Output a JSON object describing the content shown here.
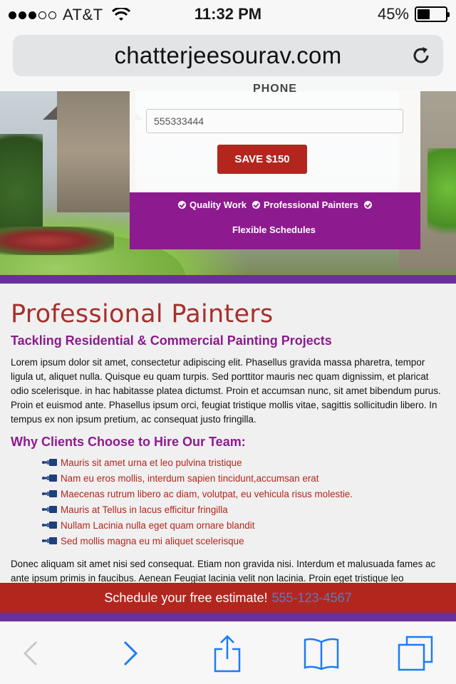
{
  "status_bar": {
    "carrier": "AT&T",
    "time": "11:32 PM",
    "battery": "45%",
    "battery_level": 0.45,
    "signal_bars_filled": 3,
    "signal_bars_total": 5
  },
  "browser": {
    "url": "chatterjeesourav.com"
  },
  "form": {
    "phone_label": "PHONE",
    "phone_value": "555333444",
    "save_label": "SAVE $150",
    "features": [
      "Quality Work",
      "Professional Painters",
      "Flexible Schedules"
    ]
  },
  "main": {
    "title": "Professional Painters",
    "subtitle": "Tackling Residential & Commercial Painting Projects",
    "paragraph": "Lorem ipsum dolor sit amet, consectetur adipiscing elit. Phasellus gravida massa pharetra, tempor ligula ut, aliquet nulla. Quisque eu quam turpis. Sed porttitor mauris nec quam dignissim, et plaricat odio scelerisque. in hac habitasse platea dictumst. Proin et accumsan nunc, sit amet bibendum purus. Proin et euismod ante. Phasellus ipsum orci, feugiat tristique mollis vitae, sagittis sollicitudin libero. In tempus ex non ipsum pretium, ac consequat justo fringilla.",
    "why_title": "Why Clients Choose to Hire Our Team:",
    "reasons": [
      "Mauris sit amet urna et leo pulvina tristique",
      "Nam eu eros mollis, interdum sapien tincidunt,accumsan erat",
      "Maecenas rutrum libero ac diam, volutpat, eu vehicula risus molestie.",
      "Mauris at Tellus in lacus efficitur fringilla",
      "Nullam Lacinia nulla eget quam ornare blandit",
      "Sed mollis magna eu mi aliquet scelerisque"
    ],
    "paragraph2": "Donec aliquam sit amet nisi sed consequat. Etiam non gravida nisi. Interdum et malusuada fames ac ante ipsum primis in faucibus. Aenean Feugiat lacinia velit non lacinia. Proin eget tristique leo"
  },
  "cta": {
    "text": "Schedule your free estimate!",
    "phone": "555-123-4567"
  },
  "toolbar": {
    "icons": [
      "back-icon",
      "forward-icon",
      "share-icon",
      "bookmarks-icon",
      "tabs-icon"
    ]
  },
  "colors": {
    "brand_red": "#b3261e",
    "brand_purple": "#8e1a8f",
    "rule_purple": "#6a2f9c",
    "ios_blue": "#1a7cf5"
  }
}
